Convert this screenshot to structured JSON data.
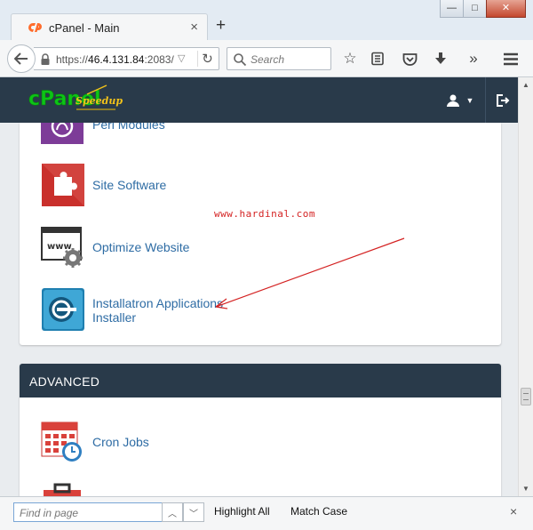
{
  "browser": {
    "tab_title": "cPanel - Main",
    "tab_close": "×",
    "new_tab": "+",
    "url_prefix": "https://",
    "url_host": "46.4.131.84",
    "url_suffix": ":2083/",
    "search_placeholder": "Search",
    "window_controls": {
      "minimize": "—",
      "maximize": "□",
      "close": "✕"
    }
  },
  "header": {
    "logo_text": "cPanel",
    "logo_tag": "Speedup"
  },
  "panel1": {
    "items": [
      {
        "label": "Perl Modules",
        "icon": "perl-modules-icon"
      },
      {
        "label": "Site Software",
        "icon": "puzzle-icon"
      },
      {
        "label": "Optimize Website",
        "icon": "www-gear-icon"
      },
      {
        "label_line1": "Installatron Applications",
        "label_line2": "Installer",
        "icon": "installatron-icon"
      }
    ]
  },
  "advanced": {
    "heading": "ADVANCED",
    "items": [
      {
        "label": "Cron Jobs",
        "icon": "calendar-clock-icon"
      }
    ]
  },
  "watermark": "www.hardinal.com",
  "findbar": {
    "placeholder": "Find in page",
    "highlight_all": "Highlight All",
    "match_case": "Match Case",
    "close": "×"
  },
  "colors": {
    "header_bg": "#293a4a",
    "link": "#2e6ca4",
    "annotation": "#d42222"
  }
}
